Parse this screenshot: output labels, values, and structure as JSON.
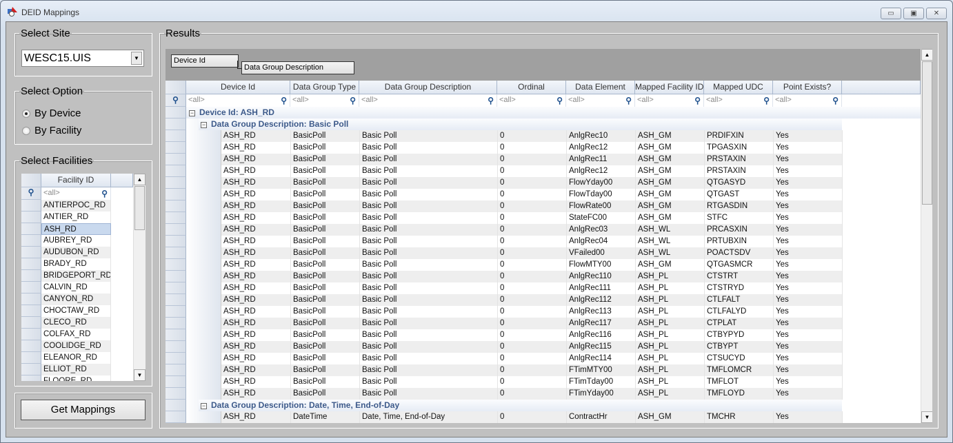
{
  "window": {
    "title": "DEID Mappings",
    "minimize": "▭",
    "restore": "▣",
    "close": "✕"
  },
  "site": {
    "legend": "Select Site",
    "value": "WESC15.UIS"
  },
  "option": {
    "legend": "Select Option",
    "by_device": "By Device",
    "by_facility": "By Facility",
    "selected": "By Device"
  },
  "facilities": {
    "legend": "Select Facilities",
    "header": "Facility ID",
    "filter": "<all>",
    "selected": "ASH_RD",
    "items": [
      "ANTIERPOC_RD",
      "ANTIER_RD",
      "ASH_RD",
      "AUBREY_RD",
      "AUDUBON_RD",
      "BRADY_RD",
      "BRIDGEPORT_RD",
      "CALVIN_RD",
      "CANYON_RD",
      "CHOCTAW_RD",
      "CLECO_RD",
      "COLFAX_RD",
      "COOLIDGE_RD",
      "ELEANOR_RD",
      "ELLIOT_RD",
      "FLOORE_RD"
    ]
  },
  "get_mappings": "Get Mappings",
  "results": {
    "legend": "Results",
    "group_by": [
      "Device Id",
      "Data Group Description"
    ],
    "columns": [
      "Device Id",
      "Data Group Type",
      "Data Group Description",
      "Ordinal",
      "Data Element",
      "Mapped Facility ID",
      "Mapped UDC",
      "Point Exists?"
    ],
    "filter": "<all>",
    "groups": [
      {
        "device_label": "Device Id: ASH_RD",
        "subgroups": [
          {
            "label": "Data Group Description: Basic Poll",
            "rows": [
              [
                "ASH_RD",
                "BasicPoll",
                "Basic Poll",
                "0",
                "AnlgRec10",
                "ASH_GM",
                "PRDIFXIN",
                "Yes"
              ],
              [
                "ASH_RD",
                "BasicPoll",
                "Basic Poll",
                "0",
                "AnlgRec12",
                "ASH_GM",
                "TPGASXIN",
                "Yes"
              ],
              [
                "ASH_RD",
                "BasicPoll",
                "Basic Poll",
                "0",
                "AnlgRec11",
                "ASH_GM",
                "PRSTAXIN",
                "Yes"
              ],
              [
                "ASH_RD",
                "BasicPoll",
                "Basic Poll",
                "0",
                "AnlgRec12",
                "ASH_GM",
                "PRSTAXIN",
                "Yes"
              ],
              [
                "ASH_RD",
                "BasicPoll",
                "Basic Poll",
                "0",
                "FlowYday00",
                "ASH_GM",
                "QTGASYD",
                "Yes"
              ],
              [
                "ASH_RD",
                "BasicPoll",
                "Basic Poll",
                "0",
                "FlowTday00",
                "ASH_GM",
                "QTGAST",
                "Yes"
              ],
              [
                "ASH_RD",
                "BasicPoll",
                "Basic Poll",
                "0",
                "FlowRate00",
                "ASH_GM",
                "RTGASDIN",
                "Yes"
              ],
              [
                "ASH_RD",
                "BasicPoll",
                "Basic Poll",
                "0",
                "StateFC00",
                "ASH_GM",
                "STFC",
                "Yes"
              ],
              [
                "ASH_RD",
                "BasicPoll",
                "Basic Poll",
                "0",
                "AnlgRec03",
                "ASH_WL",
                "PRCASXIN",
                "Yes"
              ],
              [
                "ASH_RD",
                "BasicPoll",
                "Basic Poll",
                "0",
                "AnlgRec04",
                "ASH_WL",
                "PRTUBXIN",
                "Yes"
              ],
              [
                "ASH_RD",
                "BasicPoll",
                "Basic Poll",
                "0",
                "VFailed00",
                "ASH_WL",
                "POACTSDV",
                "Yes"
              ],
              [
                "ASH_RD",
                "BasicPoll",
                "Basic Poll",
                "0",
                "FlowMTY00",
                "ASH_GM",
                "QTGASMCR",
                "Yes"
              ],
              [
                "ASH_RD",
                "BasicPoll",
                "Basic Poll",
                "0",
                "AnlgRec110",
                "ASH_PL",
                "CTSTRT",
                "Yes"
              ],
              [
                "ASH_RD",
                "BasicPoll",
                "Basic Poll",
                "0",
                "AnlgRec111",
                "ASH_PL",
                "CTSTRYD",
                "Yes"
              ],
              [
                "ASH_RD",
                "BasicPoll",
                "Basic Poll",
                "0",
                "AnlgRec112",
                "ASH_PL",
                "CTLFALT",
                "Yes"
              ],
              [
                "ASH_RD",
                "BasicPoll",
                "Basic Poll",
                "0",
                "AnlgRec113",
                "ASH_PL",
                "CTLFALYD",
                "Yes"
              ],
              [
                "ASH_RD",
                "BasicPoll",
                "Basic Poll",
                "0",
                "AnlgRec117",
                "ASH_PL",
                "CTPLAT",
                "Yes"
              ],
              [
                "ASH_RD",
                "BasicPoll",
                "Basic Poll",
                "0",
                "AnlgRec116",
                "ASH_PL",
                "CTBYPYD",
                "Yes"
              ],
              [
                "ASH_RD",
                "BasicPoll",
                "Basic Poll",
                "0",
                "AnlgRec115",
                "ASH_PL",
                "CTBYPT",
                "Yes"
              ],
              [
                "ASH_RD",
                "BasicPoll",
                "Basic Poll",
                "0",
                "AnlgRec114",
                "ASH_PL",
                "CTSUCYD",
                "Yes"
              ],
              [
                "ASH_RD",
                "BasicPoll",
                "Basic Poll",
                "0",
                "FTimMTY00",
                "ASH_PL",
                "TMFLOMCR",
                "Yes"
              ],
              [
                "ASH_RD",
                "BasicPoll",
                "Basic Poll",
                "0",
                "FTimTday00",
                "ASH_PL",
                "TMFLOT",
                "Yes"
              ],
              [
                "ASH_RD",
                "BasicPoll",
                "Basic Poll",
                "0",
                "FTimYday00",
                "ASH_PL",
                "TMFLOYD",
                "Yes"
              ]
            ]
          },
          {
            "label": "Data Group Description: Date, Time, End-of-Day",
            "rows": [
              [
                "ASH_RD",
                "DateTime",
                "Date, Time, End-of-Day",
                "0",
                "ContractHr",
                "ASH_GM",
                "TMCHR",
                "Yes"
              ]
            ]
          }
        ]
      }
    ]
  }
}
